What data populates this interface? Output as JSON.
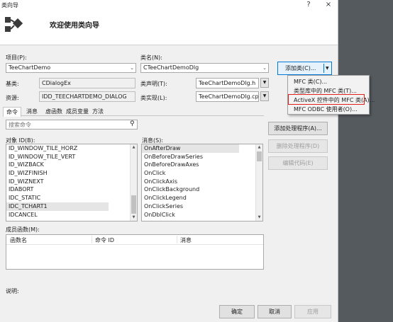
{
  "dialog": {
    "title": "类向导",
    "help": "?",
    "close": "×",
    "welcome": "欢迎使用类向导"
  },
  "project": {
    "label": "项目(P):",
    "value": "TeeChartDemo"
  },
  "classname": {
    "label": "类名(N):",
    "value": "CTeeChartDemoDlg"
  },
  "add_class": {
    "label": "添加类(C)..."
  },
  "base": {
    "label": "基类:",
    "value": "CDialogEx"
  },
  "resource": {
    "label": "资源:",
    "value": "IDD_TEECHARTDEMO_DIALOG"
  },
  "decl": {
    "label": "类声明(T):",
    "value": "TeeChartDemoDlg.h"
  },
  "impl": {
    "label": "类实现(L):",
    "value": "TeeChartDemoDlg.cpp"
  },
  "tabs": [
    "命令",
    "消息",
    "虚函数",
    "成员变量",
    "方法"
  ],
  "search": {
    "placeholder": "搜索命令"
  },
  "objects": {
    "label": "对象 ID(B):",
    "items": [
      "ID_WINDOW_TILE_HORZ",
      "ID_WINDOW_TILE_VERT",
      "ID_WIZBACK",
      "ID_WIZFINISH",
      "ID_WIZNEXT",
      "IDABORT",
      "IDC_STATIC",
      "IDC_TCHART1",
      "IDCANCEL"
    ]
  },
  "messages": {
    "label": "消息(S):",
    "items": [
      "OnAfterDraw",
      "OnBeforeDrawSeries",
      "OnBeforeDrawAxes",
      "OnClick",
      "OnClickAxis",
      "OnClickBackground",
      "OnClickLegend",
      "OnClickSeries",
      "OnDblClick"
    ]
  },
  "actions": {
    "add_handler": "添加处理程序(A)...",
    "delete_handler": "删除处理程序(D)",
    "edit_code": "编辑代码(E)"
  },
  "members": {
    "label": "成员函数(M):",
    "columns": [
      "函数名",
      "命令 ID",
      "消息"
    ]
  },
  "description": {
    "label": "说明:"
  },
  "footer": {
    "ok": "确定",
    "cancel": "取消",
    "apply": "应用"
  },
  "menu": {
    "items": [
      "MFC 类(C)...",
      "类型库中的 MFC 类(T)...",
      "ActiveX 控件中的 MFC 类(A)...",
      "MFC ODBC 使用者(O)..."
    ]
  },
  "colors": {
    "highlight": "#e0201a",
    "background": "#555a5f"
  }
}
